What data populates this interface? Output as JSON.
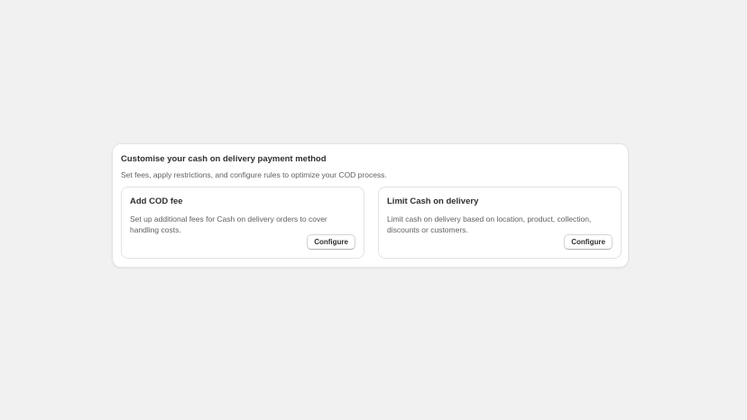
{
  "section": {
    "title": "Customise your cash on delivery payment method",
    "description": "Set fees, apply restrictions, and configure rules to optimize your COD process."
  },
  "cards": [
    {
      "title": "Add COD fee",
      "description": "Set up additional fees for Cash on delivery orders to cover handling costs.",
      "button_label": "Configure"
    },
    {
      "title": "Limit Cash on delivery",
      "description": "Limit cash on delivery based on location, product, collection, discounts or customers.",
      "button_label": "Configure"
    }
  ]
}
